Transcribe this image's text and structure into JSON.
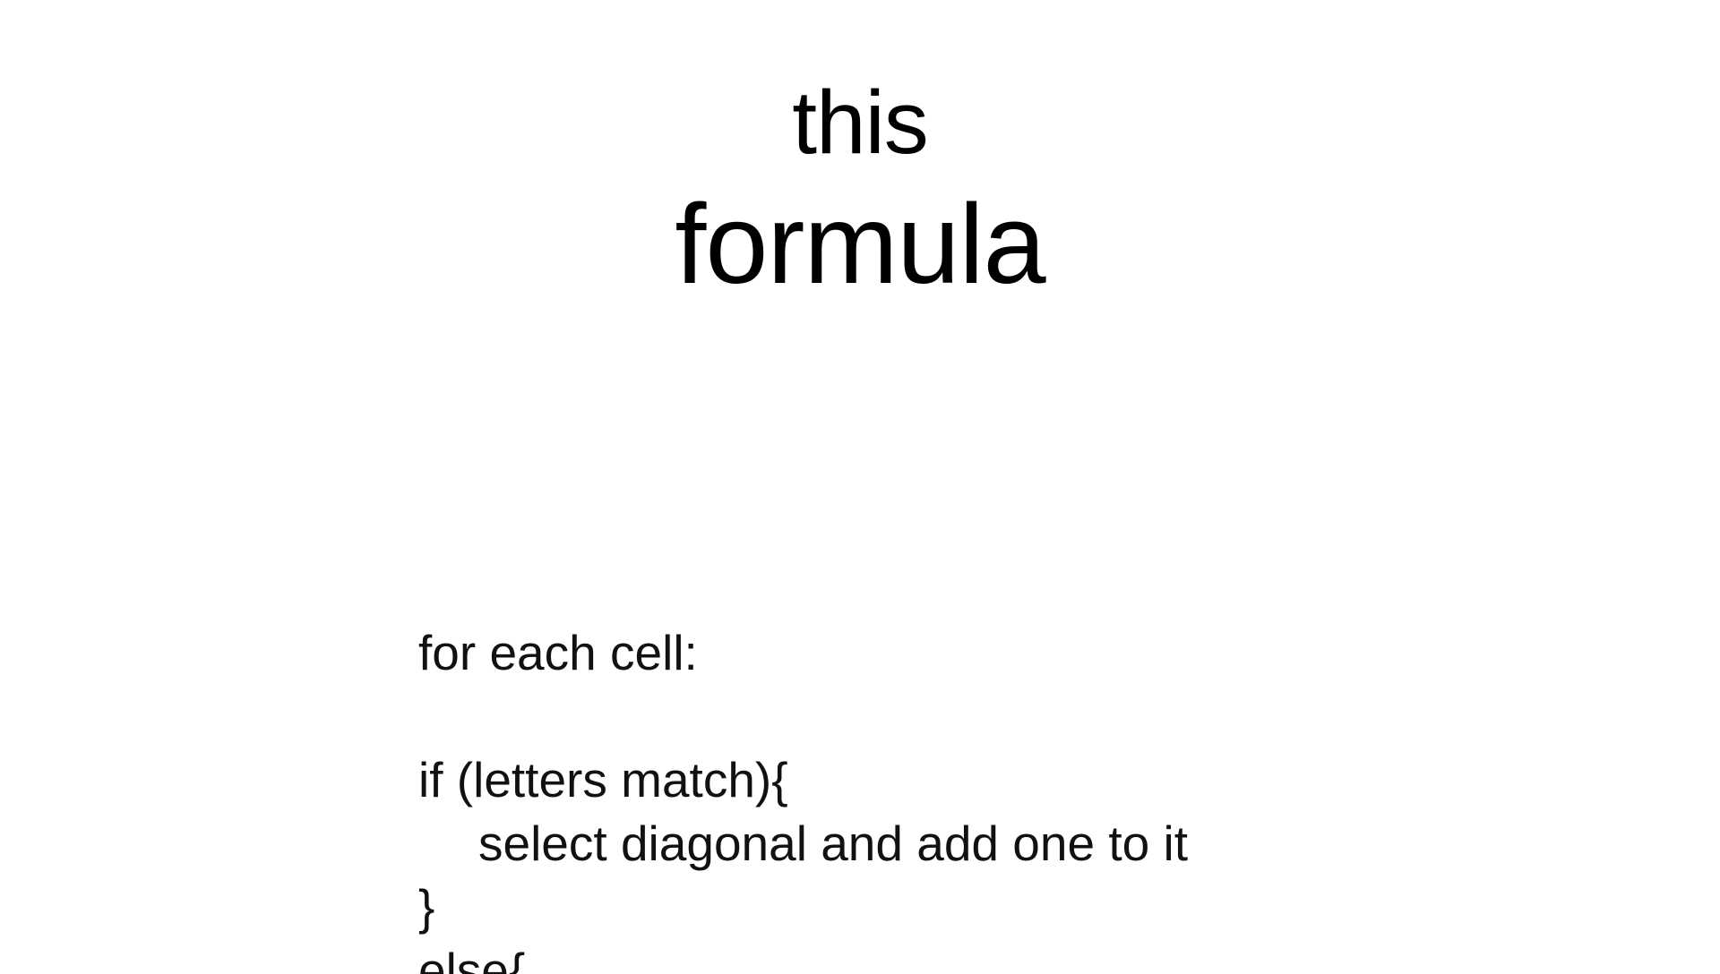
{
  "title": {
    "line1": "this",
    "line2": "formula"
  },
  "code": {
    "line1": "for each cell:",
    "line2": "if (letters match){",
    "line3": "select diagonal and add one to it",
    "line4": "}",
    "line5": "else{"
  }
}
